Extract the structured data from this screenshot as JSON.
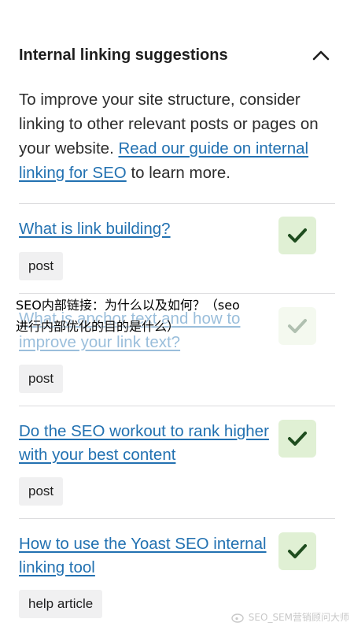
{
  "panel": {
    "title": "Internal linking suggestions",
    "intro_text": "To improve your site structure, consider linking to other relevant posts or pages on your website.",
    "intro_link": "Read our guide on internal linking for SEO",
    "intro_suffix": "to learn more."
  },
  "suggestions": [
    {
      "title": "What is link building?",
      "type": "post",
      "linked": true
    },
    {
      "title": "What is anchor text and how to improve your link text?",
      "type": "post",
      "linked": true
    },
    {
      "title": "Do the SEO workout to rank higher with your best content",
      "type": "post",
      "linked": true
    },
    {
      "title": "How to use the Yoast SEO internal linking tool",
      "type": "help article",
      "linked": true
    }
  ],
  "overlay": {
    "line1": "SEO内部链接：为什么以及如何？（seo",
    "line2": "进行内部优化的目的是什么）"
  },
  "watermark": {
    "text": "SEO_SEM营销顾问大师"
  },
  "colors": {
    "link": "#2271b1",
    "check_bg": "#e0f0d4",
    "check_icon": "#1f4d1f",
    "badge_bg": "#f0f0f1"
  }
}
